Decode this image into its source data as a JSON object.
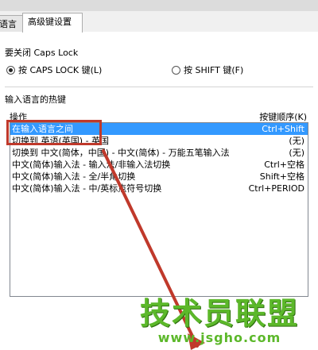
{
  "tabs": [
    {
      "label": "语言栏",
      "active": false
    },
    {
      "label": "高级键设置",
      "active": true
    }
  ],
  "caps_lock": {
    "title": "要关闭 Caps Lock",
    "option_caps": "按 CAPS LOCK 键(L)",
    "option_shift": "按 SHIFT 键(F)",
    "selected": "caps"
  },
  "hotkeys": {
    "title": "输入语言的热键",
    "col_action": "操作",
    "col_key": "按键顺序(K)",
    "rows": [
      {
        "action": "在输入语言之间",
        "key": "Ctrl+Shift",
        "selected": true
      },
      {
        "action": "切换到 英语(英国) - 英国",
        "key": "(无)",
        "selected": false
      },
      {
        "action": "切换到 中文(简体，中国) - 中文(简体) - 万能五笔输入法",
        "key": "(无)",
        "selected": false
      },
      {
        "action": "中文(简体)输入法 - 输入法/非输入法切换",
        "key": "Ctrl+空格",
        "selected": false
      },
      {
        "action": "中文(简体)输入法 - 全/半角切换",
        "key": "Shift+空格",
        "selected": false
      },
      {
        "action": "中文(简体)输入法 - 中/英标点符号切换",
        "key": "Ctrl+PERIOD",
        "selected": false
      }
    ]
  },
  "watermark": {
    "logo": "技术员联盟",
    "url": "www.jsgho.com"
  },
  "colors": {
    "selection": "#3399ff",
    "annotation_red": "#c0392b",
    "watermark_green": "#5cb82a"
  }
}
